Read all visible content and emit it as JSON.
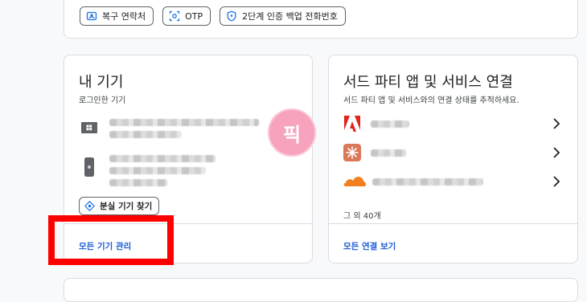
{
  "top_chips": [
    {
      "label": "복구 연락처",
      "icon": "contact-icon"
    },
    {
      "label": "OTP",
      "icon": "otp-icon"
    },
    {
      "label": "2단계 인증 백업 전화번호",
      "icon": "shield-icon"
    }
  ],
  "devices": {
    "title": "내 기기",
    "subtitle": "로그인한 기기",
    "items": [
      {
        "icon": "windows-computer-icon"
      },
      {
        "icon": "phone-icon"
      }
    ],
    "find_button": "분실 기기 찾기",
    "manage_link": "모든 기기 관리"
  },
  "apps": {
    "title": "서드 파티 앱 및 서비스 연결",
    "subtitle": "서드 파티 앱 및 서비스와의 연결 상태를 추적하세요.",
    "items": [
      {
        "icon": "adobe-logo-icon",
        "color": "#e1251b"
      },
      {
        "icon": "claude-logo-icon",
        "color": "#d97757"
      },
      {
        "icon": "cloudflare-logo-icon",
        "color": "#f38020"
      }
    ],
    "more_count": "그 외 40개",
    "view_all_link": "모든 연결 보기"
  },
  "overlay": {
    "badge_text": "픽",
    "highlight_color": "#ff0000"
  }
}
